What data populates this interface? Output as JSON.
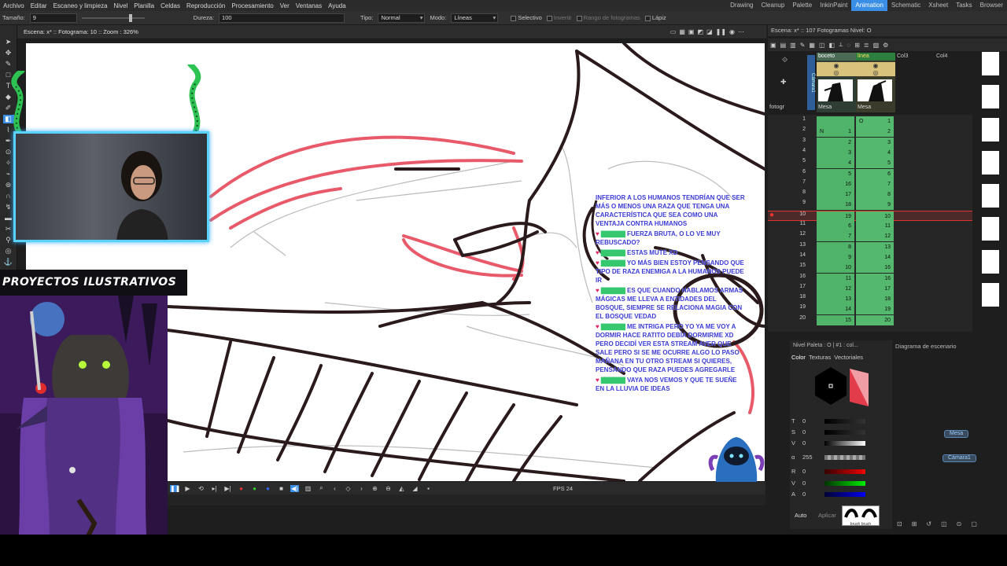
{
  "menu": [
    "Archivo",
    "Editar",
    "Escaneo y limpieza",
    "Nivel",
    "Planilla",
    "Celdas",
    "Reproducción",
    "Procesamiento",
    "Ver",
    "Ventanas",
    "Ayuda"
  ],
  "rooms": [
    "Drawing",
    "Cleanup",
    "Palette",
    "InkinPaint",
    "Animation",
    "Schematic",
    "Xsheet",
    "Tasks",
    "Browser"
  ],
  "active_room": "Animation",
  "tool_options": {
    "size_label": "Tamaño:",
    "size_value": "9",
    "hardness_label": "Dureza:",
    "hardness_value": "100",
    "type_label": "Tipo:",
    "type_value": "Normal",
    "mode_label": "Modo:",
    "mode_value": "Líneas",
    "selective": "Selectivo",
    "invert": "Invertir",
    "frame_range": "Rango de fotogramas",
    "pencil": "Lápiz"
  },
  "viewer": {
    "title": "Escena: x*  ::  Fotograma: 10  ::  Zoom : 326%",
    "fps_label": "FPS",
    "fps_value": "24"
  },
  "overlay": {
    "banner": "PROYECTOS ILUSTRATIVOS"
  },
  "chat": [
    {
      "text": "INFERIOR A LOS HUMANOS TENDRÍAN QUE SER MÁS O MENOS UNA RAZA QUE TENGA UNA CARACTERÍSTICA QUE SEA COMO UNA VENTAJA CONTRA HUMANOS"
    },
    {
      "text": "FUERZA BRUTA, O LO VE MUY REBUSCADO?"
    },
    {
      "text": "ESTAS MUTE XD"
    },
    {
      "text": "YO MÁS BIEN ESTOY PENSANDO QUE TIPO DE RAZA ENEMIGA A LA HUMANOS PUEDE IR"
    },
    {
      "text": "ES QUE CUANDO HABLAMOS ARMAS MÁGICAS ME LLEVA A ENTIDADES DEL BOSQUE, SIEMPRE SE RELACIONA MAGIA CON EL BOSQUE VEDAD"
    },
    {
      "text": "ME INTRIGA PERO YO YA ME VOY A DORMIR HACE RATITO DEBÍA DORMIRME XD PERO DECIDÍ VER ESTA STREAM AVER QUE SALE PERO SI SE ME OCURRE ALGO LO PASO MAÑANA EN TU OTRO STREAM SI QUIERES, PENSANDO QUE RAZA PUEDES AGREGARLE"
    },
    {
      "text": "VAYA NOS VEMOS Y QUE TE SUEÑE EN LA LLUVIA DE IDEAS"
    }
  ],
  "xsheet": {
    "title": "Escena: x*  ::  107 Fotogramas  Nivel: O",
    "frame_label": "fotogr",
    "columns": [
      {
        "name": "boceto",
        "color": "#7ec48e",
        "level": "Mesa"
      },
      {
        "name": "linea",
        "color": "#e5d27a",
        "level": "Mesa"
      },
      {
        "name": "Col3",
        "color": "#262626",
        "level": ""
      },
      {
        "name": "Col4",
        "color": "#262626",
        "level": ""
      }
    ],
    "camera_label": "Cámara1",
    "rows": [
      {
        "frame": "1",
        "c1": "",
        "c2": "1",
        "c1mark": "",
        "c2mark": "O"
      },
      {
        "frame": "2",
        "c1": "1",
        "c2": "2",
        "c1mark": "N",
        "c2mark": ""
      },
      {
        "frame": "3",
        "c1": "2",
        "c2": "3",
        "c1mark": "",
        "c2mark": ""
      },
      {
        "frame": "4",
        "c1": "3",
        "c2": "4",
        "c1mark": "",
        "c2mark": ""
      },
      {
        "frame": "5",
        "c1": "4",
        "c2": "5",
        "c1mark": "",
        "c2mark": ""
      },
      {
        "frame": "6",
        "c1": "5",
        "c2": "6",
        "c1mark": "",
        "c2mark": ""
      },
      {
        "frame": "7",
        "c1": "16",
        "c2": "7",
        "c1mark": "",
        "c2mark": ""
      },
      {
        "frame": "8",
        "c1": "17",
        "c2": "8",
        "c1mark": "",
        "c2mark": ""
      },
      {
        "frame": "9",
        "c1": "18",
        "c2": "9",
        "c1mark": "",
        "c2mark": ""
      },
      {
        "frame": "10",
        "c1": "19",
        "c2": "10",
        "c1mark": "",
        "c2mark": ""
      },
      {
        "frame": "11",
        "c1": "6",
        "c2": "11",
        "c1mark": "",
        "c2mark": ""
      },
      {
        "frame": "12",
        "c1": "7",
        "c2": "12",
        "c1mark": "",
        "c2mark": ""
      },
      {
        "frame": "13",
        "c1": "8",
        "c2": "13",
        "c1mark": "",
        "c2mark": ""
      },
      {
        "frame": "14",
        "c1": "9",
        "c2": "14",
        "c1mark": "",
        "c2mark": ""
      },
      {
        "frame": "15",
        "c1": "10",
        "c2": "16",
        "c1mark": "",
        "c2mark": ""
      },
      {
        "frame": "16",
        "c1": "11",
        "c2": "16",
        "c1mark": "",
        "c2mark": ""
      },
      {
        "frame": "17",
        "c1": "12",
        "c2": "17",
        "c1mark": "",
        "c2mark": ""
      },
      {
        "frame": "18",
        "c1": "13",
        "c2": "18",
        "c1mark": "",
        "c2mark": ""
      },
      {
        "frame": "19",
        "c1": "14",
        "c2": "19",
        "c1mark": "",
        "c2mark": ""
      },
      {
        "frame": "20",
        "c1": "15",
        "c2": "20",
        "c1mark": "",
        "c2mark": ""
      }
    ],
    "current_frame": "10"
  },
  "style_editor": {
    "header": "Nivel Paleta : O | #1 : col...",
    "tabs": [
      "Color",
      "Texturas",
      "Vectoriales"
    ],
    "channels": [
      {
        "name": "T",
        "value": "0"
      },
      {
        "name": "S",
        "value": "0"
      },
      {
        "name": "V",
        "value": "0"
      },
      {
        "name": "α",
        "value": "255"
      },
      {
        "name": "R",
        "value": "0"
      },
      {
        "name": "V",
        "value": "0"
      },
      {
        "name": "A",
        "value": "0"
      }
    ],
    "auto": "Auto",
    "apply": "Aplicar",
    "brush_labels": "brush brush"
  },
  "schematic": {
    "title": "Diagrama de escenario",
    "nodes": [
      "Mesa",
      "Cámara1"
    ]
  },
  "colors": {
    "accent": "#3a8ee6",
    "sketch_red": "#e85a6a",
    "line_dark": "#2a1a1c",
    "chat_blue": "#3b3bd6",
    "webcam_border": "#5ad2ff"
  }
}
